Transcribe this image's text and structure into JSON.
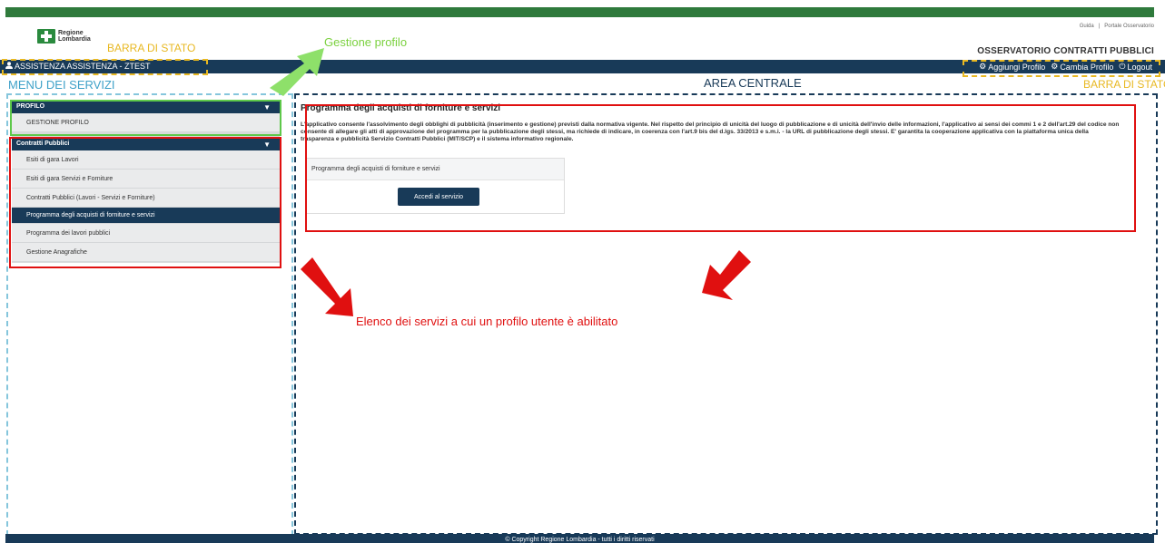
{
  "header": {
    "logo_text": "Regione Lombardia",
    "links": [
      "Guida",
      "Portale Osservatorio"
    ],
    "site_title": "OSSERVATORIO CONTRATTI PUBBLICI"
  },
  "navbar": {
    "user": "ASSISTENZA ASSISTENZA - ZTEST",
    "actions": [
      "Aggiungi Profilo",
      "Cambia Profilo",
      "Logout"
    ]
  },
  "annotations": {
    "barra_stato_left": "BARRA DI STATO",
    "barra_stato_right": "BARRA DI STATO",
    "gestione_profilo": "Gestione profilo",
    "menu_servizi": "MENU DEI SERVIZI",
    "area_centrale": "AREA CENTRALE",
    "elenco": "Elenco dei servizi a cui un profilo utente è abilitato"
  },
  "sidebar": {
    "section1": "PROFILO",
    "section1_items": [
      "GESTIONE PROFILO"
    ],
    "section2": "Contratti Pubblici",
    "section2_items": [
      "Esiti di gara Lavori",
      "Esiti di gara Servizi e Forniture",
      "Contratti Pubblici (Lavori - Servizi e Forniture)",
      "Programma degli acquisti di forniture e servizi",
      "Programma dei lavori pubblici",
      "Gestione Anagrafiche"
    ],
    "active_item": "Programma degli acquisti di forniture e servizi"
  },
  "main": {
    "title": "Programma degli acquisti di forniture e servizi",
    "description": "L'applicativo consente l'assolvimento degli obblighi di pubblicità (inserimento e gestione) previsti dalla normativa vigente. Nel rispetto del principio di unicità del luogo di pubblicazione e di unicità dell'invio delle informazioni, l'applicativo ai sensi dei commi 1 e 2 dell'art.29 del codice non consente di allegare gli atti di approvazione del programma per la pubblicazione degli stessi, ma richiede di indicare, in coerenza con l'art.9 bis del d.lgs. 33/2013 e s.m.i. - la URL di pubblicazione degli stessi. E' garantita la cooperazione applicativa con la piattaforma unica della trasparenza e pubblicità Servizio Contratti Pubblici (MIT/SCP) e il sistema informativo regionale.",
    "card_title": "Programma degli acquisti di forniture e servizi",
    "card_button": "Accedi al servizio"
  },
  "footer": {
    "text": "© Copyright Regione Lombardia - tutti i diritti riservati"
  },
  "colors": {
    "navy": "#183a58",
    "brand_green": "#2f7a3c",
    "annotation_orange": "#e8b822",
    "annotation_blue": "#3ea1c8",
    "annotation_red": "#e01010",
    "annotation_green": "#7bd13f"
  }
}
